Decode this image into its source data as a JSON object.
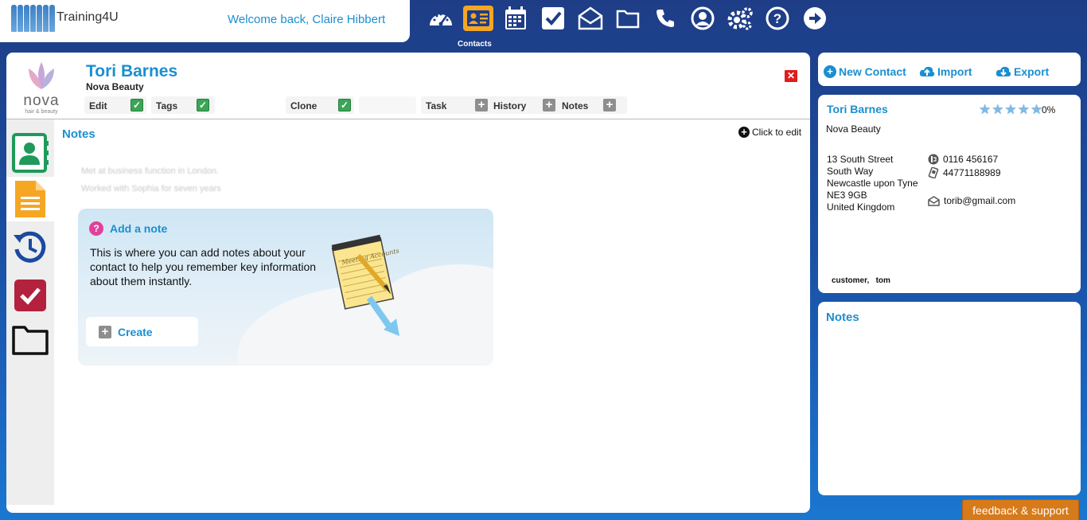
{
  "app": {
    "name": "Training4U",
    "welcome": "Welcome back, Claire Hibbert"
  },
  "topnav": {
    "items": [
      {
        "icon": "dashboard-icon"
      },
      {
        "icon": "contacts-icon",
        "active": true,
        "label": "Contacts"
      },
      {
        "icon": "calendar-icon"
      },
      {
        "icon": "tasks-icon"
      },
      {
        "icon": "mail-icon"
      },
      {
        "icon": "folder-icon"
      },
      {
        "icon": "phone-icon"
      },
      {
        "icon": "user-account-icon"
      },
      {
        "icon": "settings-icon"
      },
      {
        "icon": "help-icon"
      },
      {
        "icon": "logout-icon"
      }
    ],
    "active_label": "Contacts"
  },
  "contact": {
    "name": "Tori Barnes",
    "company": "Nova Beauty",
    "logo": {
      "word": "nova",
      "sub": "hair & beauty"
    },
    "actions": {
      "edit": "Edit",
      "tags": "Tags",
      "clone": "Clone",
      "task": "Task",
      "history": "History",
      "notes": "Notes"
    }
  },
  "notes_section": {
    "title": "Notes",
    "click_to_edit": "Click to edit",
    "existing": [
      "Met at business function in London.",
      "Worked with Sophia for seven years"
    ],
    "add_note": {
      "title": "Add a note",
      "description": "This is where you can add notes about your contact to help you remember key information about them instantly.",
      "create_label": "Create",
      "notepad_text": "Meeting Accounts"
    }
  },
  "sidebar_tabs": [
    "contact-details-tab",
    "notes-tab",
    "history-tab",
    "tasks-tab",
    "files-tab"
  ],
  "right_toolbar": {
    "new_contact": "New Contact",
    "import": "Import",
    "export": "Export"
  },
  "summary": {
    "name": "Tori Barnes",
    "rating_stars": 5,
    "rating_value": 0,
    "completion": "0%",
    "company": "Nova Beauty",
    "address": [
      "13 South Street",
      "South Way",
      "Newcastle upon Tyne",
      "NE3 9GB",
      "United Kingdom"
    ],
    "phone": "0116 456167",
    "mobile": "44771188989",
    "email": "torib@gmail.com",
    "tags": "customer,   tom"
  },
  "notes_panel": {
    "title": "Notes"
  },
  "feedback": "feedback & support",
  "colors": {
    "accent": "#1b8fd0",
    "brand_bg": "#1e3d86",
    "active_nav": "#f5a623",
    "feedback": "#d67a1a",
    "check": "#3aa655",
    "close": "#e21b1b"
  }
}
